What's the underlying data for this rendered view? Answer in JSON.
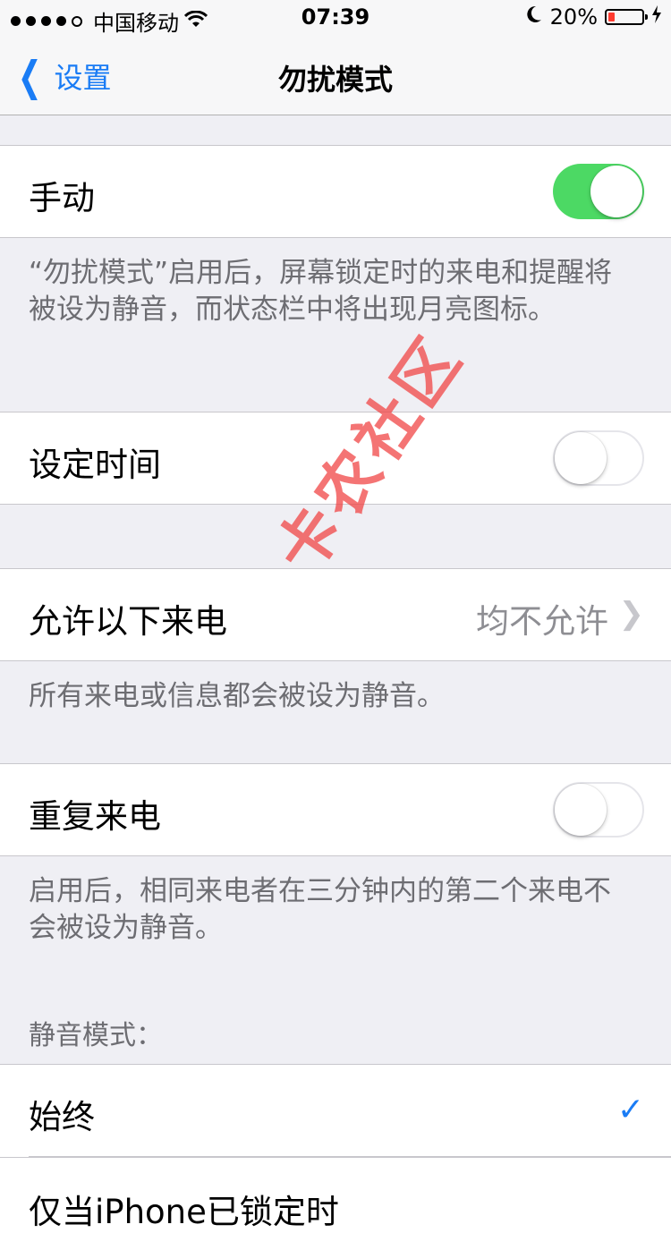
{
  "status_bar": {
    "carrier": "中国移动",
    "time": "07:39",
    "battery_percent": "20%",
    "battery_level": 0.2,
    "icons": [
      "signal-dots-icon",
      "wifi-icon",
      "moon-icon",
      "battery-icon",
      "charging-icon"
    ]
  },
  "nav": {
    "back_label": "设置",
    "title": "勿扰模式"
  },
  "manual": {
    "label": "手动",
    "on": true,
    "footer": "“勿扰模式”启用后，屏幕锁定时的来电和提醒将被设为静音，而状态栏中将出现月亮图标。"
  },
  "scheduled": {
    "label": "设定时间",
    "on": false
  },
  "allow_calls": {
    "label": "允许以下来电",
    "value": "均不允许",
    "footer": "所有来电或信息都会被设为静音。"
  },
  "repeated_calls": {
    "label": "重复来电",
    "on": false,
    "footer": "启用后，相同来电者在三分钟内的第二个来电不会被设为静音。"
  },
  "silence": {
    "header": "静音模式：",
    "option_always": "始终",
    "option_locked_partial": "仅当iPhone已锁定时"
  },
  "watermark": "卡农社区",
  "colors": {
    "accent": "#1a7cf5",
    "toggle_on": "#4cd964",
    "background": "#efeff4",
    "battery_low": "#ff3b30"
  }
}
